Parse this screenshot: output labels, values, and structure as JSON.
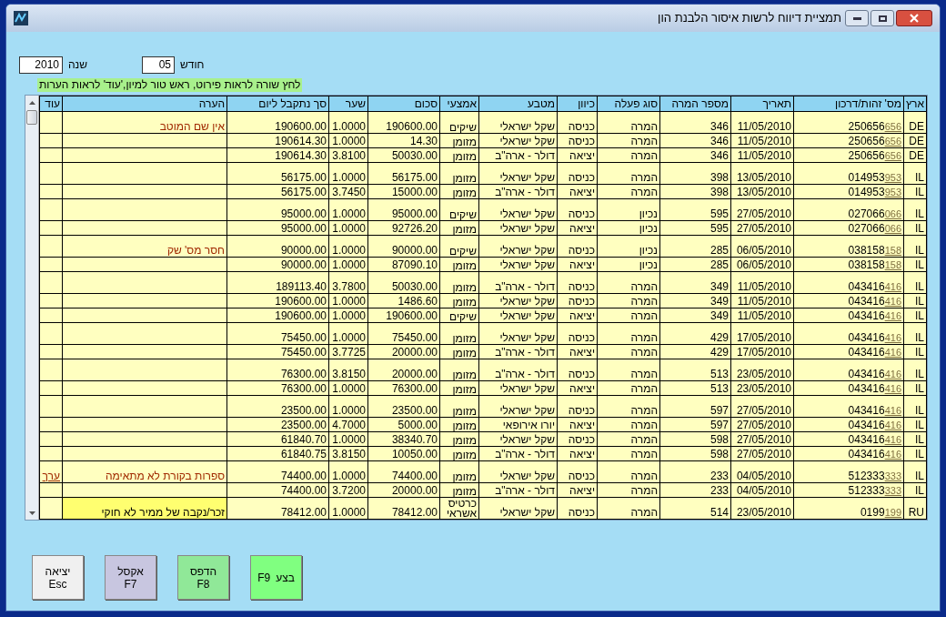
{
  "window": {
    "title": "תמציית דיווח לרשות איסור הלבנת הון"
  },
  "filters": [
    {
      "label": "חודש",
      "value": "05"
    },
    {
      "label": "שנה",
      "value": "2010"
    }
  ],
  "hint": "לחץ שורה לראות פירוט, ראש טור למיון,'עוד' לראות הערות",
  "table": {
    "columns": [
      "ארץ",
      "מס' זהות/דרכון",
      "תאריך",
      "מספר המרה",
      "סוג פעלה",
      "כיוון",
      "מטבע",
      "אמצעי",
      "סכום",
      "שער",
      "סך נתקבל ליום",
      "הערה",
      "עוד"
    ],
    "rows": [
      {
        "group_start": true,
        "country": "DE",
        "id": "250656",
        "id_suffix": "656",
        "date": "11/05/2010",
        "number": "346",
        "type": "המרה",
        "direction": "כניסה",
        "currency": "שקל ישראלי",
        "means": "שיקים",
        "amount": "190600.00",
        "rate": "1.0000",
        "total": "190600.00",
        "note": "אין שם המוטב",
        "highlight": false
      },
      {
        "group_start": false,
        "country": "DE",
        "id": "250656",
        "id_suffix": "656",
        "date": "11/05/2010",
        "number": "346",
        "type": "המרה",
        "direction": "כניסה",
        "currency": "שקל ישראלי",
        "means": "מזומן",
        "amount": "14.30",
        "rate": "1.0000",
        "total": "190614.30",
        "highlight": false
      },
      {
        "group_start": false,
        "country": "DE",
        "id": "250656",
        "id_suffix": "656",
        "date": "11/05/2010",
        "number": "346",
        "type": "המרה",
        "direction": "יציאה",
        "currency": "דולר - ארה\"ב",
        "means": "מזומן",
        "amount": "50030.00",
        "rate": "3.8100",
        "total": "190614.30",
        "highlight": false
      },
      {
        "group_start": true,
        "country": "IL",
        "id": "014953",
        "id_suffix": "953",
        "date": "13/05/2010",
        "number": "398",
        "type": "המרה",
        "direction": "כניסה",
        "currency": "שקל ישראלי",
        "means": "מזומן",
        "amount": "56175.00",
        "rate": "1.0000",
        "total": "56175.00",
        "highlight": false
      },
      {
        "group_start": false,
        "country": "IL",
        "id": "014953",
        "id_suffix": "953",
        "date": "13/05/2010",
        "number": "398",
        "type": "המרה",
        "direction": "יציאה",
        "currency": "דולר - ארה\"ב",
        "means": "מזומן",
        "amount": "15000.00",
        "rate": "3.7450",
        "total": "56175.00",
        "highlight": false
      },
      {
        "group_start": true,
        "country": "IL",
        "id": "027066",
        "id_suffix": "066",
        "date": "27/05/2010",
        "number": "595",
        "type": "נכיון",
        "direction": "כניסה",
        "currency": "שקל ישראלי",
        "means": "שיקים",
        "amount": "95000.00",
        "rate": "1.0000",
        "total": "95000.00",
        "highlight": false
      },
      {
        "group_start": false,
        "country": "IL",
        "id": "027066",
        "id_suffix": "066",
        "date": "27/05/2010",
        "number": "595",
        "type": "נכיון",
        "direction": "יציאה",
        "currency": "שקל ישראלי",
        "means": "מזומן",
        "amount": "92726.20",
        "rate": "1.0000",
        "total": "95000.00",
        "highlight": false
      },
      {
        "group_start": true,
        "country": "IL",
        "id": "038158",
        "id_suffix": "158",
        "date": "06/05/2010",
        "number": "285",
        "type": "נכיון",
        "direction": "כניסה",
        "currency": "שקל ישראלי",
        "means": "שיקים",
        "amount": "90000.00",
        "rate": "1.0000",
        "total": "90000.00",
        "note": "חסר מס' שק",
        "highlight": false
      },
      {
        "group_start": false,
        "country": "IL",
        "id": "038158",
        "id_suffix": "158",
        "date": "06/05/2010",
        "number": "285",
        "type": "נכיון",
        "direction": "יציאה",
        "currency": "שקל ישראלי",
        "means": "מזומן",
        "amount": "87090.10",
        "rate": "1.0000",
        "total": "90000.00",
        "highlight": false
      },
      {
        "group_start": true,
        "country": "IL",
        "id": "043416",
        "id_suffix": "416",
        "date": "11/05/2010",
        "number": "349",
        "type": "המרה",
        "direction": "כניסה",
        "currency": "דולר - ארה\"ב",
        "means": "מזומן",
        "amount": "50030.00",
        "rate": "3.7800",
        "total": "189113.40",
        "highlight": false
      },
      {
        "group_start": false,
        "country": "IL",
        "id": "043416",
        "id_suffix": "416",
        "date": "11/05/2010",
        "number": "349",
        "type": "המרה",
        "direction": "כניסה",
        "currency": "שקל ישראלי",
        "means": "מזומן",
        "amount": "1486.60",
        "rate": "1.0000",
        "total": "190600.00",
        "highlight": false
      },
      {
        "group_start": false,
        "country": "IL",
        "id": "043416",
        "id_suffix": "416",
        "date": "11/05/2010",
        "number": "349",
        "type": "המרה",
        "direction": "יציאה",
        "currency": "שקל ישראלי",
        "means": "שיקים",
        "amount": "190600.00",
        "rate": "1.0000",
        "total": "190600.00",
        "highlight": false
      },
      {
        "group_start": true,
        "country": "IL",
        "id": "043416",
        "id_suffix": "416",
        "date": "17/05/2010",
        "number": "429",
        "type": "המרה",
        "direction": "כניסה",
        "currency": "שקל ישראלי",
        "means": "מזומן",
        "amount": "75450.00",
        "rate": "1.0000",
        "total": "75450.00",
        "highlight": false
      },
      {
        "group_start": false,
        "country": "IL",
        "id": "043416",
        "id_suffix": "416",
        "date": "17/05/2010",
        "number": "429",
        "type": "המרה",
        "direction": "יציאה",
        "currency": "דולר - ארה\"ב",
        "means": "מזומן",
        "amount": "20000.00",
        "rate": "3.7725",
        "total": "75450.00",
        "highlight": false
      },
      {
        "group_start": true,
        "country": "IL",
        "id": "043416",
        "id_suffix": "416",
        "date": "23/05/2010",
        "number": "513",
        "type": "המרה",
        "direction": "כניסה",
        "currency": "דולר - ארה\"ב",
        "means": "מזומן",
        "amount": "20000.00",
        "rate": "3.8150",
        "total": "76300.00",
        "highlight": false
      },
      {
        "group_start": false,
        "country": "IL",
        "id": "043416",
        "id_suffix": "416",
        "date": "23/05/2010",
        "number": "513",
        "type": "המרה",
        "direction": "יציאה",
        "currency": "שקל ישראלי",
        "means": "מזומן",
        "amount": "76300.00",
        "rate": "1.0000",
        "total": "76300.00",
        "highlight": false
      },
      {
        "group_start": true,
        "country": "IL",
        "id": "043416",
        "id_suffix": "416",
        "date": "27/05/2010",
        "number": "597",
        "type": "המרה",
        "direction": "כניסה",
        "currency": "שקל ישראלי",
        "means": "מזומן",
        "amount": "23500.00",
        "rate": "1.0000",
        "total": "23500.00",
        "highlight": false
      },
      {
        "group_start": false,
        "country": "IL",
        "id": "043416",
        "id_suffix": "416",
        "date": "27/05/2010",
        "number": "597",
        "type": "המרה",
        "direction": "יציאה",
        "currency": "יורו אירופאי",
        "means": "מזומן",
        "amount": "5000.00",
        "rate": "4.7000",
        "total": "23500.00",
        "highlight": false
      },
      {
        "group_start": false,
        "country": "IL",
        "id": "043416",
        "id_suffix": "416",
        "date": "27/05/2010",
        "number": "598",
        "type": "המרה",
        "direction": "כניסה",
        "currency": "שקל ישראלי",
        "means": "מזומן",
        "amount": "38340.70",
        "rate": "1.0000",
        "total": "61840.70",
        "highlight": false
      },
      {
        "group_start": false,
        "country": "IL",
        "id": "043416",
        "id_suffix": "416",
        "date": "27/05/2010",
        "number": "598",
        "type": "המרה",
        "direction": "יציאה",
        "currency": "דולר - ארה\"ב",
        "means": "מזומן",
        "amount": "10050.00",
        "rate": "3.8150",
        "total": "61840.75",
        "highlight": false
      },
      {
        "group_start": true,
        "country": "IL",
        "id": "512333",
        "id_suffix": "333",
        "date": "04/05/2010",
        "number": "233",
        "type": "המרה",
        "direction": "כניסה",
        "currency": "שקל ישראלי",
        "means": "מזומן",
        "amount": "74400.00",
        "rate": "1.0000",
        "total": "74400.00",
        "note": "ספרות בקורת לא מתאימה",
        "more": "ערך",
        "highlight": false
      },
      {
        "group_start": false,
        "country": "IL",
        "id": "512333",
        "id_suffix": "333",
        "date": "04/05/2010",
        "number": "233",
        "type": "המרה",
        "direction": "יציאה",
        "currency": "דולר - ארה\"ב",
        "means": "מזומן",
        "amount": "20000.00",
        "rate": "3.7200",
        "total": "74400.00",
        "highlight": false
      },
      {
        "group_start": true,
        "country": "RU",
        "id": "0199",
        "id_suffix": "199",
        "date": "23/05/2010",
        "number": "514",
        "type": "המרה",
        "direction": "כניסה",
        "currency": "שקל ישראלי",
        "means": "כרטיס אשראי",
        "amount": "78412.00",
        "rate": "1.0000",
        "total": "78412.00",
        "note": "זכר/נקבה של ממיר לא חוקי",
        "highlight": true
      }
    ]
  },
  "buttons": [
    {
      "label": "בצע",
      "key": "F9",
      "stacked": false,
      "color": "#80ff80"
    },
    {
      "label": "הדפס",
      "key": "F8",
      "stacked": true,
      "color": "#90e898"
    },
    {
      "label": "אקסל",
      "key": "F7",
      "stacked": true,
      "color": "#c8c6e0"
    },
    {
      "label": "יציאה",
      "key": "Esc",
      "stacked": true,
      "color": "#f0f0f0"
    }
  ]
}
